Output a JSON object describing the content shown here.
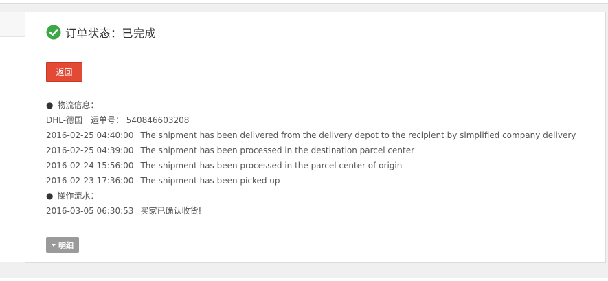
{
  "order": {
    "status_text": "订单状态：已完成",
    "status_color": "#3aa845"
  },
  "back_button": {
    "label": "返回",
    "color": "#e24a35"
  },
  "logistics": {
    "heading": "物流信息：",
    "carrier": "DHL-德国",
    "tracking_label": "运单号：",
    "tracking_number": "540846603208",
    "events": [
      {
        "time": "2016-02-25 04:40:00",
        "desc": "The shipment has been delivered from the delivery depot to the recipient by simplified company delivery"
      },
      {
        "time": "2016-02-25 04:39:00",
        "desc": "The shipment has been processed in the destination parcel center"
      },
      {
        "time": "2016-02-24 15:56:00",
        "desc": "The shipment has been processed in the parcel center of origin"
      },
      {
        "time": "2016-02-23 17:36:00",
        "desc": "The shipment has been picked up"
      }
    ]
  },
  "operations": {
    "heading": "操作流水：",
    "entries": [
      {
        "time": "2016-03-05 06:30:53",
        "desc": "买家已确认收货!"
      }
    ]
  },
  "detail_toggle": {
    "label": "明细",
    "icon": "triangle-down-icon"
  },
  "bullet": "●"
}
